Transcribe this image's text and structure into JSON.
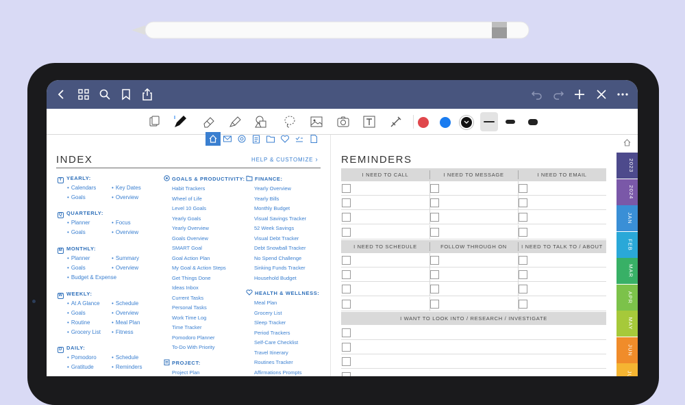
{
  "colors": {
    "background": "#d9daf5",
    "topbar": "#48557e",
    "accent": "#3a7fd0",
    "red_swatch": "#e0474c",
    "blue_swatch": "#1a7cf0",
    "black_swatch": "#111111"
  },
  "topbar": {
    "left_icons": [
      "back-icon",
      "grid-icon",
      "search-icon",
      "bookmark-icon",
      "share-icon"
    ],
    "right_icons": [
      "undo-icon",
      "redo-icon",
      "plus-icon",
      "close-icon",
      "more-icon"
    ]
  },
  "toolbar": {
    "tools": [
      "page-icon",
      "pen-icon",
      "eraser-icon",
      "highlighter-icon",
      "shapes-icon",
      "lasso-icon",
      "image-icon",
      "camera-icon",
      "text-icon",
      "elements-icon"
    ],
    "colors": [
      "red",
      "blue",
      "black"
    ],
    "stroke_widths": [
      "thin",
      "medium",
      "thick"
    ]
  },
  "index": {
    "title": "INDEX",
    "help": "HELP & CUSTOMIZE",
    "help_arrow": "›",
    "sections": [
      {
        "key": "Y",
        "title": "YEARLY:",
        "col1": [
          "Calendars",
          "Goals"
        ],
        "col2": [
          "Key Dates",
          "Overview"
        ]
      },
      {
        "key": "Q",
        "title": "QUARTERLY:",
        "col1": [
          "Planner",
          "Goals"
        ],
        "col2": [
          "Focus",
          "Overview"
        ]
      },
      {
        "key": "M",
        "title": "MONTHLY:",
        "col1": [
          "Planner",
          "Goals",
          "Budget & Expense"
        ],
        "col2": [
          "Summary",
          "Overview"
        ]
      },
      {
        "key": "W",
        "title": "WEEKLY:",
        "col1": [
          "At A Glance",
          "Goals",
          "Routine",
          "Grocery List"
        ],
        "col2": [
          "Schedule",
          "Overview",
          "Meal Plan",
          "Fitness"
        ]
      },
      {
        "key": "D",
        "title": "DAILY:",
        "col1": [
          "Pomodoro",
          "Gratitude"
        ],
        "col2": [
          "Schedule",
          "Reminders"
        ]
      }
    ],
    "goals_title": "GOALS & PRODUCTIVITY:",
    "goals_items": [
      "Habit Trackers",
      "Wheel of Life",
      "Level 10 Goals",
      "Yearly Goals",
      "Yearly Overview",
      "Goals Overview",
      "SMART Goal",
      "Goal Action Plan",
      "My Goal & Action Steps",
      "Get Things Done",
      "Ideas Inbox",
      "Current Tasks",
      "Personal Tasks",
      "Work Time Log",
      "Time Tracker",
      "Pomodoro Planner",
      "To-Do With Priority"
    ],
    "project_title": "PROJECT:",
    "project_items": [
      "Project Plan"
    ],
    "finance_title": "FINANCE:",
    "finance_items": [
      "Yearly Overview",
      "Yearly Bills",
      "Monthly Budget",
      "Visual Savings Tracker",
      "52 Week Savings",
      "Visual Debt Tracker",
      "Debt Snowball Tracker",
      "No Spend Challenge",
      "Sinking Funds Tracker",
      "Household Budget"
    ],
    "health_title": "HEALTH & WELLNESS:",
    "health_items": [
      "Meal Plan",
      "Grocery List",
      "Sleep Tracker",
      "Period Trackers",
      "Self-Care Checklist",
      "Travel Itinerary",
      "Routines Tracker",
      "Affirmations Prompts"
    ]
  },
  "reminders": {
    "title": "REMINDERS",
    "headers_1": [
      "I NEED TO CALL",
      "I NEED TO MESSAGE",
      "I NEED TO EMAIL"
    ],
    "headers_2": [
      "I NEED TO SCHEDULE",
      "FOLLOW THROUGH ON",
      "I NEED TO TALK TO / ABOUT"
    ],
    "header_3": "I WANT TO LOOK INTO / RESEARCH / INVESTIGATE"
  },
  "tabs": [
    {
      "label": "2023",
      "color": "#4d4a8c"
    },
    {
      "label": "2024",
      "color": "#7a58a8"
    },
    {
      "label": "JAN",
      "color": "#3a8fd6"
    },
    {
      "label": "FEB",
      "color": "#2aa8d8"
    },
    {
      "label": "MAR",
      "color": "#38b066"
    },
    {
      "label": "APR",
      "color": "#7cc24a"
    },
    {
      "label": "MAY",
      "color": "#a6c93a"
    },
    {
      "label": "JUN",
      "color": "#f08c2a"
    },
    {
      "label": "JUL",
      "color": "#f5b532"
    }
  ]
}
